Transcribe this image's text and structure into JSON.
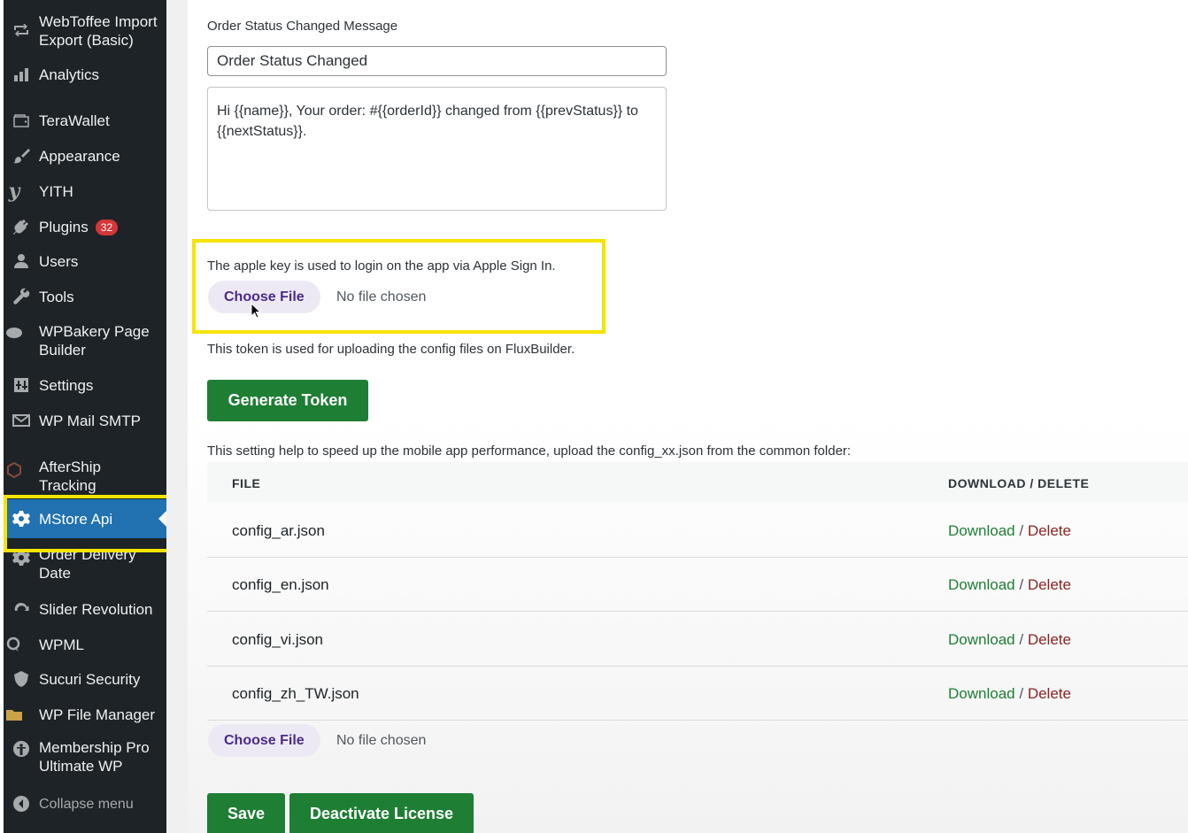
{
  "sidebar": {
    "items": [
      {
        "label_line1": "WebToffee Import",
        "label_line2": "Export (Basic)",
        "icon": "webtoffee-icon"
      },
      {
        "label": "Analytics",
        "icon": "bar-chart-icon"
      },
      {
        "label": "TeraWallet",
        "icon": "wallet-icon"
      },
      {
        "label": "Appearance",
        "icon": "paintbrush-icon"
      },
      {
        "label": "YITH",
        "icon": "yith-icon"
      },
      {
        "label": "Plugins",
        "badge": "32",
        "icon": "plug-icon"
      },
      {
        "label": "Users",
        "icon": "user-icon"
      },
      {
        "label": "Tools",
        "icon": "wrench-icon"
      },
      {
        "label_line1": "WPBakery Page",
        "label_line2": "Builder",
        "icon": "wpbakery-icon"
      },
      {
        "label": "Settings",
        "icon": "settings-icon"
      },
      {
        "label": "WP Mail SMTP",
        "icon": "mail-icon"
      },
      {
        "label_line1": "AfterShip",
        "label_line2": "Tracking",
        "icon": "aftership-icon"
      },
      {
        "label": "MStore Api",
        "icon": "gear-icon",
        "active": true
      },
      {
        "label_line1": "Order Delivery",
        "label_line2": "Date",
        "icon": "gear-icon"
      },
      {
        "label": "Slider Revolution",
        "icon": "refresh-icon"
      },
      {
        "label": "WPML",
        "icon": "wpml-icon"
      },
      {
        "label": "Sucuri Security",
        "icon": "shield-icon"
      },
      {
        "label": "WP File Manager",
        "icon": "folder-icon"
      },
      {
        "label_line1": "Membership Pro",
        "label_line2": "Ultimate WP",
        "icon": "membership-icon"
      },
      {
        "label": "Collapse menu",
        "icon": "collapse-icon"
      }
    ]
  },
  "order_status": {
    "section_label": "Order Status Changed Message",
    "title_value": "Order Status Changed",
    "message_value": "Hi {{name}}, Your order: #{{orderId}} changed from {{prevStatus}} to {{nextStatus}}."
  },
  "apple_key": {
    "description": "The apple key is used to login on the app via Apple Sign In.",
    "choose_file_label": "Choose File",
    "no_file_text": "No file chosen"
  },
  "token": {
    "description": "This token is used for uploading the config files on FluxBuilder.",
    "button_label": "Generate Token"
  },
  "config_files": {
    "description": "This setting help to speed up the mobile app performance, upload the config_xx.json from the common folder:",
    "col_file": "FILE",
    "col_actions": "DOWNLOAD / DELETE",
    "download_label": "Download",
    "separator": "/",
    "delete_label": "Delete",
    "rows": [
      {
        "file": "config_ar.json"
      },
      {
        "file": "config_en.json"
      },
      {
        "file": "config_vi.json"
      },
      {
        "file": "config_zh_TW.json"
      }
    ],
    "choose_file_label": "Choose File",
    "no_file_text": "No file chosen"
  },
  "footer": {
    "save_label": "Save",
    "deactivate_label": "Deactivate License"
  },
  "colors": {
    "sidebar_bg": "#1d2327",
    "active_bg": "#2271b1",
    "green_button": "#1e7e34",
    "highlight": "#f5e400",
    "badge": "#d63638"
  }
}
